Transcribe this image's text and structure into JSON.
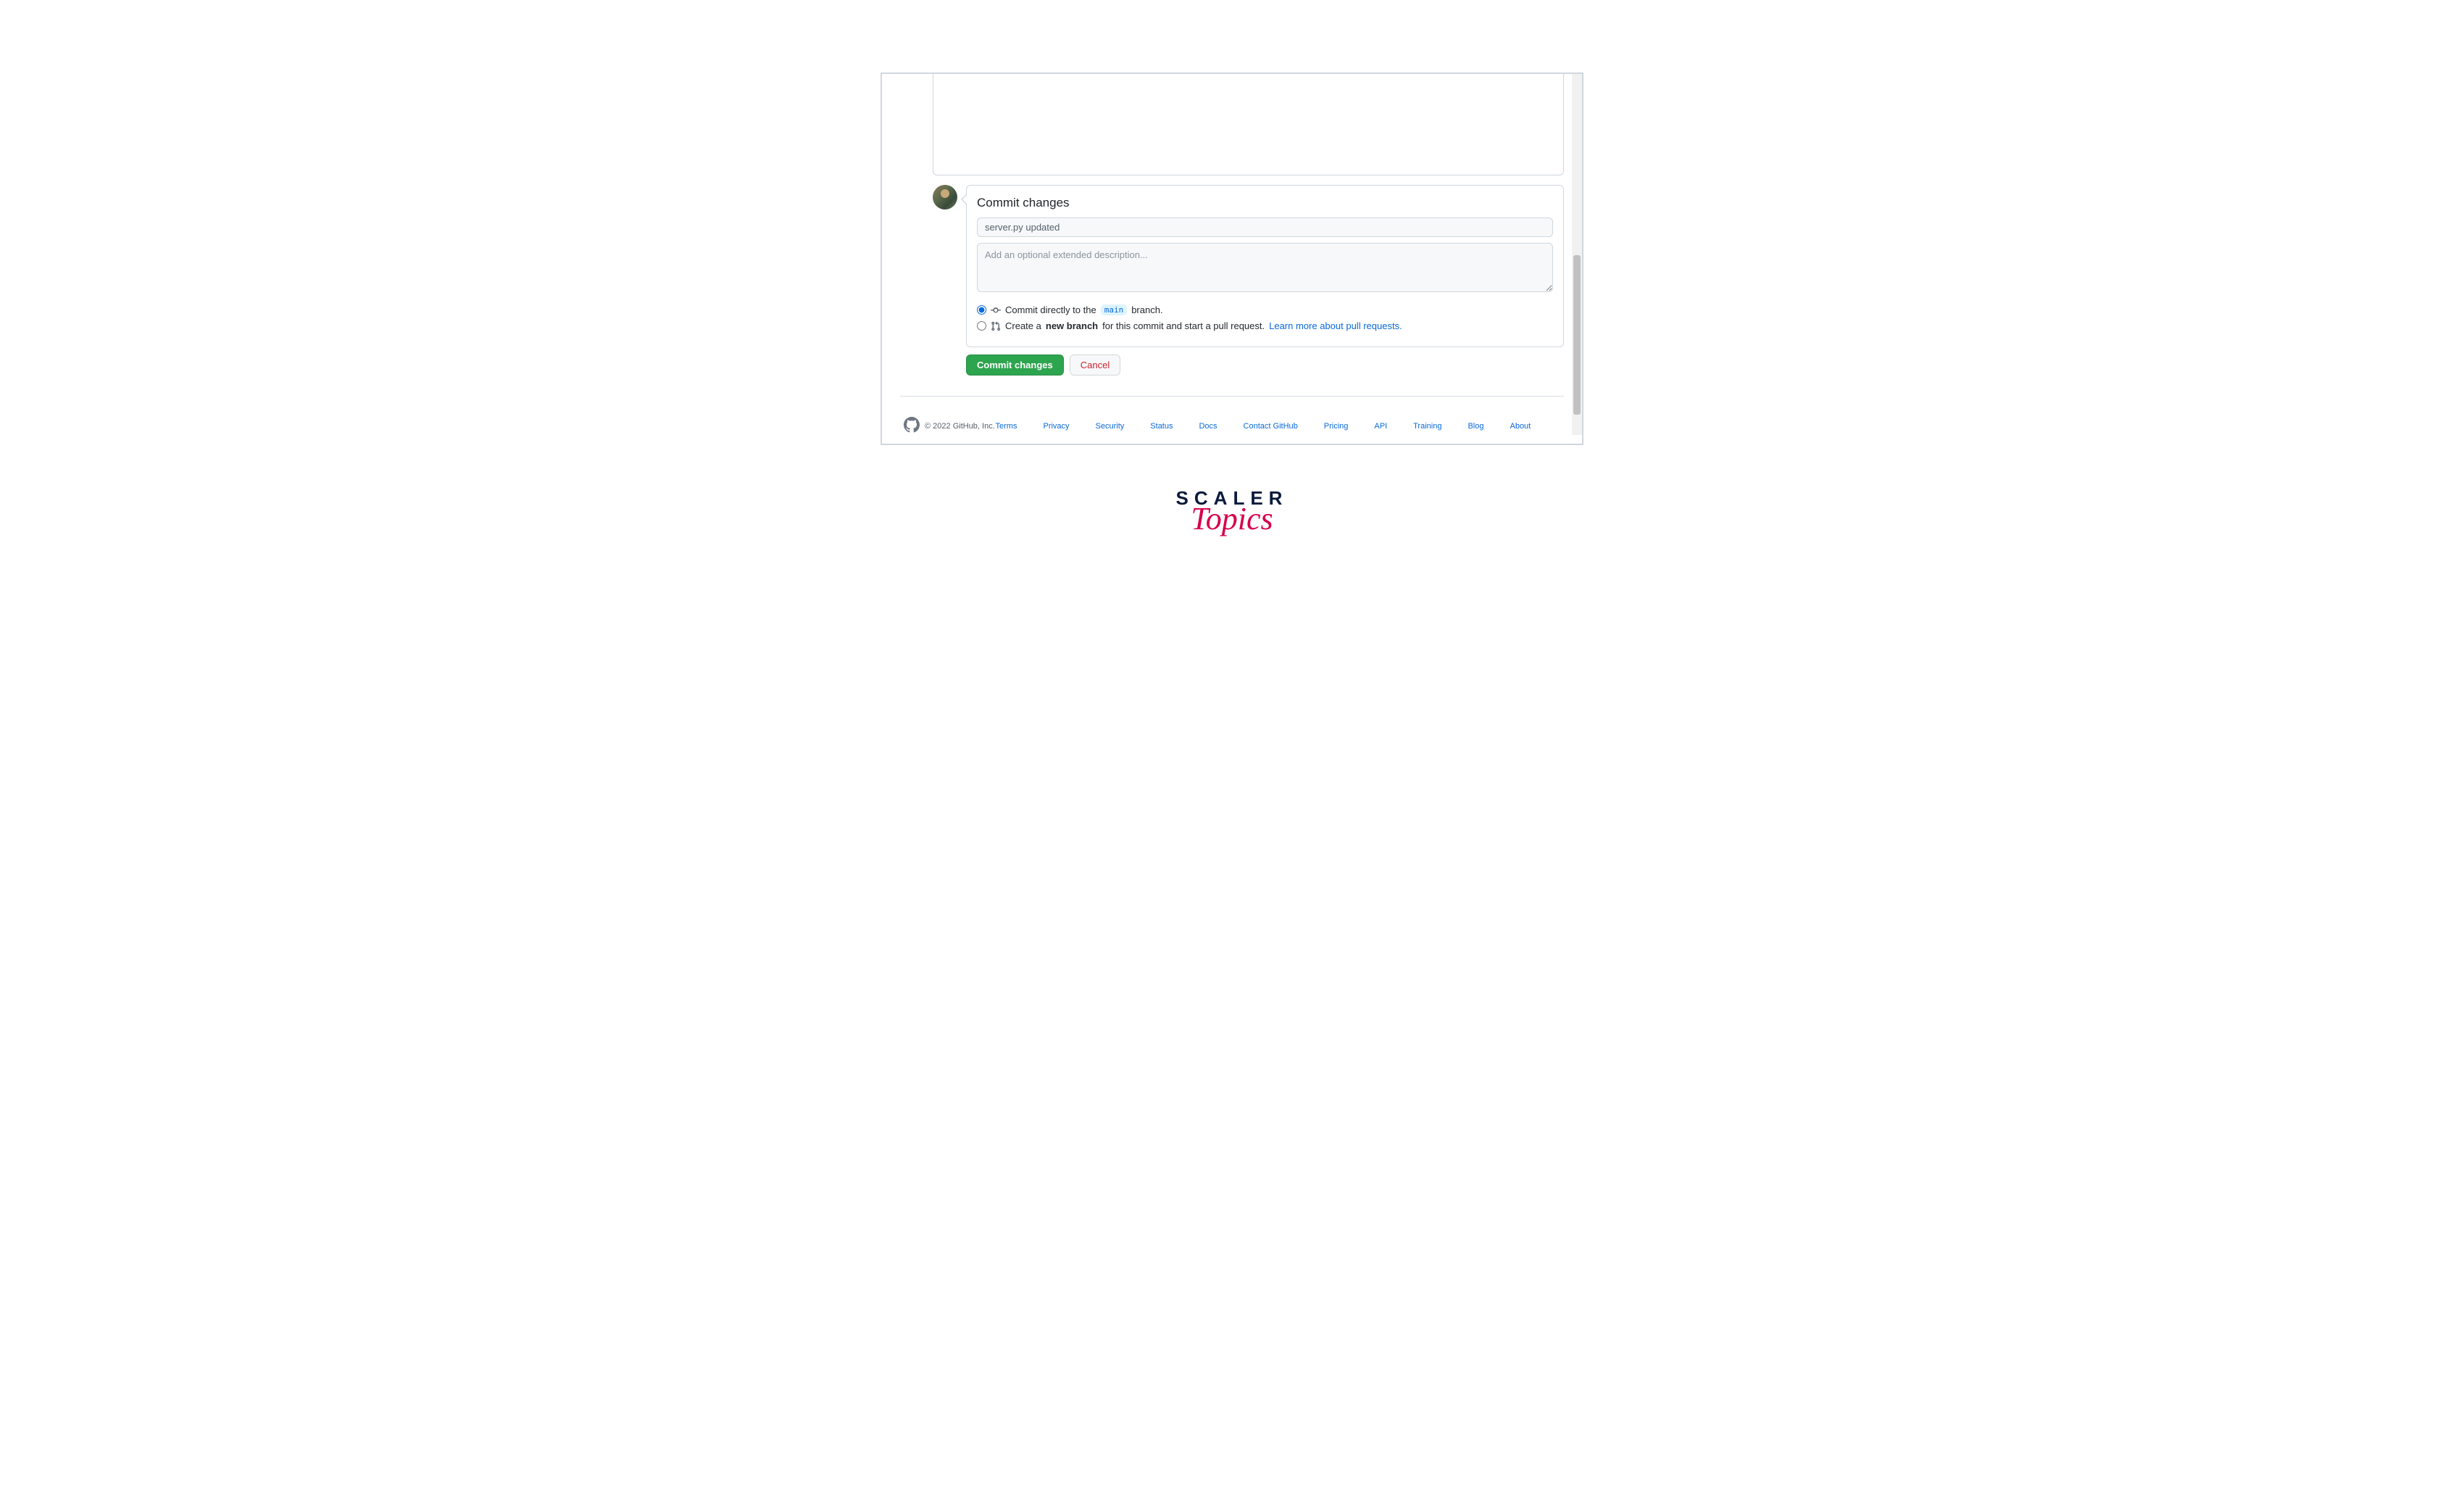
{
  "commit": {
    "heading": "Commit changes",
    "summary_value": "server.py updated",
    "description_placeholder": "Add an optional extended description...",
    "option_direct_prefix": "Commit directly to the ",
    "option_direct_branch": "main",
    "option_direct_suffix": " branch.",
    "option_newbranch_prefix": "Create a ",
    "option_newbranch_strong": "new branch",
    "option_newbranch_middle": " for this commit and start a pull request. ",
    "option_newbranch_link": "Learn more about pull requests.",
    "commit_button": "Commit changes",
    "cancel_button": "Cancel"
  },
  "footer": {
    "copyright": "© 2022 GitHub, Inc.",
    "links": [
      "Terms",
      "Privacy",
      "Security",
      "Status",
      "Docs",
      "Contact GitHub",
      "Pricing",
      "API",
      "Training",
      "Blog",
      "About"
    ]
  },
  "watermark": {
    "line1": "SCALER",
    "line2": "Topics"
  }
}
